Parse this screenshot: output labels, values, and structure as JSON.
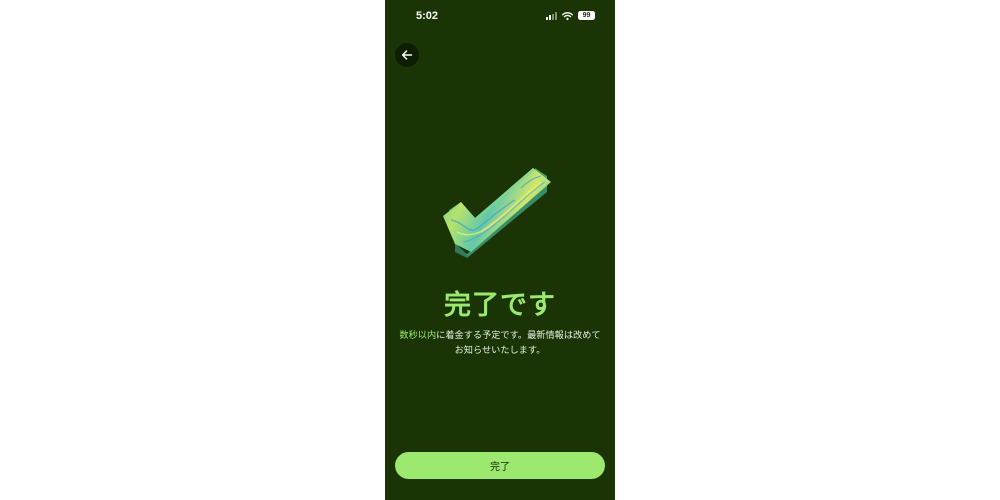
{
  "status_bar": {
    "time": "5:02",
    "battery": "99",
    "icons": [
      "cellular-signal-icon",
      "wifi-icon",
      "battery-icon"
    ]
  },
  "header": {
    "back_icon": "arrow-left-icon"
  },
  "hero": {
    "icon": "checkmark-icon"
  },
  "main": {
    "title": "完了です",
    "message_highlight": "数秒以内",
    "message_rest": "に着金する予定です。最新情報は改めてお知らせいたします。"
  },
  "footer": {
    "done_label": "完了"
  },
  "colors": {
    "background": "#1a3405",
    "accent": "#9de86e",
    "button_text": "#14260a"
  }
}
